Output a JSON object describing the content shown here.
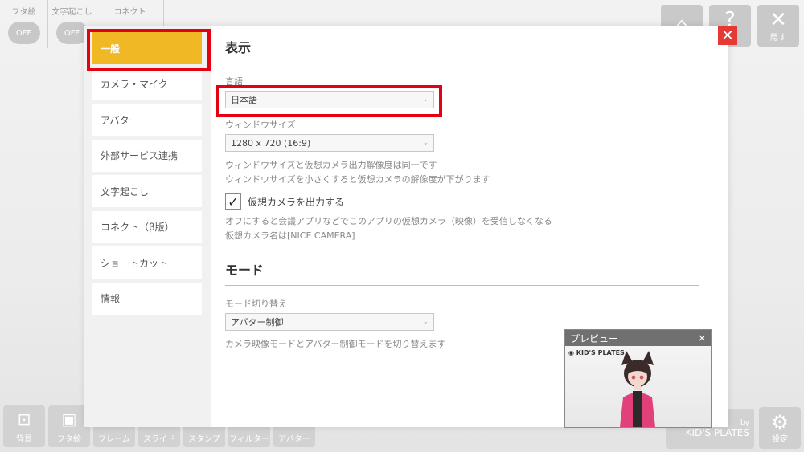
{
  "background": {
    "toggles": [
      {
        "label": "フタ絵",
        "state": "OFF"
      },
      {
        "label": "文字起こし",
        "state": "OFF"
      },
      {
        "label": "コネクト",
        "state": ""
      }
    ],
    "top_right": [
      {
        "icon": "bell-icon",
        "glyph": "⌂",
        "label": ""
      },
      {
        "icon": "help-icon",
        "glyph": "?",
        "label": "プ"
      },
      {
        "icon": "hide-icon",
        "glyph": "✕",
        "label": "隠す"
      }
    ],
    "bottom_buttons": [
      {
        "icon": "background-icon",
        "glyph": "⊡",
        "label": "背景"
      },
      {
        "icon": "lid-picture-icon",
        "glyph": "▣",
        "label": "フタ絵"
      },
      {
        "icon": "frame-icon",
        "glyph": "▭",
        "label": "フレーム"
      },
      {
        "icon": "slide-icon",
        "glyph": "▯",
        "label": "スライド"
      },
      {
        "icon": "stamp-icon",
        "glyph": "◌",
        "label": "スタンプ"
      },
      {
        "icon": "filter-icon",
        "glyph": "◍",
        "label": "フィルター"
      },
      {
        "icon": "avatar-icon",
        "glyph": "☺",
        "label": "アバター"
      }
    ],
    "brand": {
      "by": "by",
      "name": "KID'S PLATES"
    },
    "settings_label": "設定"
  },
  "sidebar": {
    "items": [
      {
        "label": "一般",
        "active": true
      },
      {
        "label": "カメラ・マイク",
        "active": false
      },
      {
        "label": "アバター",
        "active": false
      },
      {
        "label": "外部サービス連携",
        "active": false
      },
      {
        "label": "文字起こし",
        "active": false
      },
      {
        "label": "コネクト（β版）",
        "active": false
      },
      {
        "label": "ショートカット",
        "active": false
      },
      {
        "label": "情報",
        "active": false
      }
    ]
  },
  "display": {
    "title": "表示",
    "language_label": "言語",
    "language_value": "日本語",
    "window_label": "ウィンドウサイズ",
    "window_value": "1280 x 720 (16:9)",
    "window_help_1": "ウィンドウサイズと仮想カメラ出力解像度は同一です",
    "window_help_2": "ウィンドウサイズを小さくすると仮想カメラの解像度が下がります",
    "virtual_cam_label": "仮想カメラを出力する",
    "virtual_cam_checked": true,
    "virtual_cam_help_1": "オフにすると会議アプリなどでこのアプリの仮想カメラ（映像）を受信しなくなる",
    "virtual_cam_help_2": "仮想カメラ名は[NICE CAMERA]"
  },
  "mode": {
    "title": "モード",
    "switch_label": "モード切り替え",
    "switch_value": "アバター制御",
    "switch_help": "カメラ映像モードとアバター制御モードを切り替えます"
  },
  "preview": {
    "title": "プレビュー",
    "close": "×",
    "logo_text": "KID'S PLATES"
  },
  "colors": {
    "accent": "#f0b825",
    "highlight": "#e50012",
    "close_red": "#e53935"
  }
}
